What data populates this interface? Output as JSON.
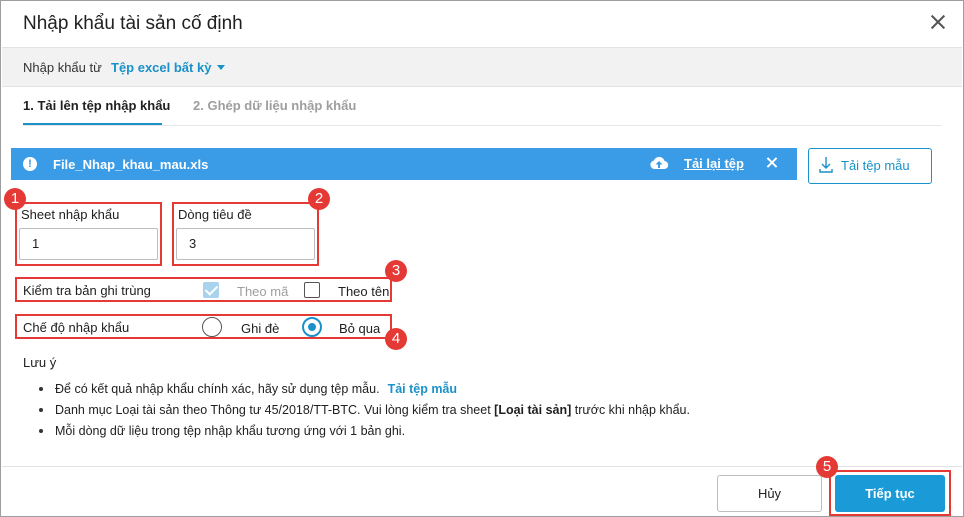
{
  "dialog": {
    "title": "Nhập khẩu tài sản cố định"
  },
  "source": {
    "label": "Nhập khẩu từ",
    "selected": "Tệp excel bất kỳ"
  },
  "tabs": [
    {
      "label": "1. Tải lên tệp nhập khẩu",
      "active": true
    },
    {
      "label": "2. Ghép dữ liệu nhập khẩu",
      "active": false
    }
  ],
  "file": {
    "name": "File_Nhap_khau_mau.xls",
    "reupload_label": "Tải lại tệp"
  },
  "template_button": {
    "label": "Tải tệp mẫu"
  },
  "sheet": {
    "label": "Sheet nhập khẩu",
    "value": "1"
  },
  "header_row": {
    "label": "Dòng tiêu đề",
    "value": "3"
  },
  "duplicate_check": {
    "label": "Kiểm tra bản ghi trùng",
    "options": [
      {
        "label": "Theo mã",
        "checked": true,
        "disabled": true
      },
      {
        "label": "Theo tên",
        "checked": false
      }
    ]
  },
  "import_mode": {
    "label": "Chế độ nhập khẩu",
    "options": [
      {
        "label": "Ghi đè",
        "selected": false
      },
      {
        "label": "Bỏ qua",
        "selected": true
      }
    ]
  },
  "notes": {
    "title": "Lưu ý",
    "items": [
      {
        "text": "Để có kết quả nhập khẩu chính xác, hãy sử dụng tệp mẫu.",
        "link": "Tải tệp mẫu"
      },
      {
        "pre": "Danh mục Loại tài sản theo Thông tư 45/2018/TT-BTC. Vui lòng kiểm tra sheet ",
        "bold": "[Loại tài sản]",
        "post": " trước khi nhập khẩu."
      },
      {
        "text": "Mỗi dòng dữ liệu trong tệp nhập khẩu tương ứng với 1 bản ghi."
      }
    ]
  },
  "footer": {
    "cancel_label": "Hủy",
    "next_label": "Tiếp tục"
  },
  "badges": [
    "1",
    "2",
    "3",
    "4",
    "5"
  ],
  "colors": {
    "accent": "#1a91c8",
    "file_bar": "#3a9be6",
    "highlight": "#e53935"
  }
}
